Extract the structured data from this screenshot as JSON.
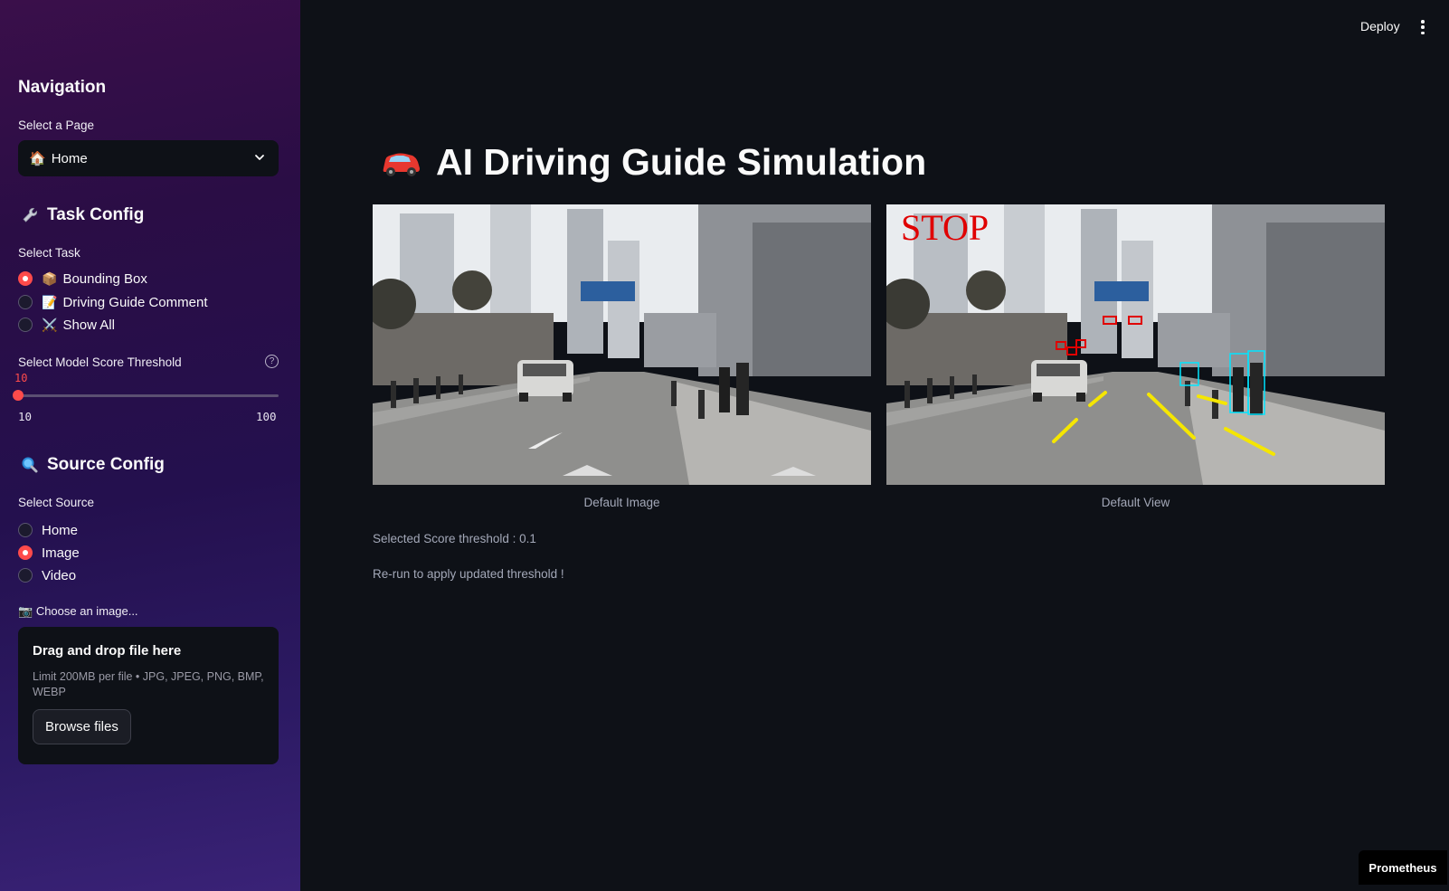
{
  "header": {
    "deploy_label": "Deploy"
  },
  "sidebar": {
    "nav_title": "Navigation",
    "page_select": {
      "label": "Select a Page",
      "value": "Home",
      "icon": "🏠"
    },
    "task_config": {
      "title": "Task Config",
      "icon": "wrench-icon",
      "select_label": "Select Task",
      "options": [
        {
          "emoji": "📦",
          "label": "Bounding Box",
          "selected": true
        },
        {
          "emoji": "📝",
          "label": "Driving Guide Comment",
          "selected": false
        },
        {
          "emoji": "⚔️",
          "label": "Show All",
          "selected": false
        }
      ]
    },
    "threshold": {
      "label": "Select Model Score Threshold",
      "value": "10",
      "min": "10",
      "max": "100"
    },
    "source_config": {
      "title": "Source Config",
      "icon": "magnifier-icon",
      "select_label": "Select Source",
      "options": [
        {
          "label": "Home",
          "selected": false
        },
        {
          "label": "Image",
          "selected": true
        },
        {
          "label": "Video",
          "selected": false
        }
      ]
    },
    "uploader": {
      "label_icon": "📷",
      "label": "Choose an image...",
      "title": "Drag and drop file here",
      "limit": "Limit 200MB per file • JPG, JPEG, PNG, BMP, WEBP",
      "button": "Browse files"
    }
  },
  "main": {
    "title": "AI Driving Guide Simulation",
    "title_icon": "car-icon",
    "images": [
      {
        "caption": "Default Image"
      },
      {
        "caption": "Default View",
        "overlay_text": "STOP"
      }
    ],
    "score_text": "Selected Score threshold : 0.1",
    "rerun_text": "Re-run to apply updated threshold !"
  },
  "footer_badge": "Prometheus",
  "colors": {
    "accent": "#ff4b4b",
    "background": "#0e1117",
    "lane": "#ffeb3b",
    "box": "#00e5ff"
  }
}
